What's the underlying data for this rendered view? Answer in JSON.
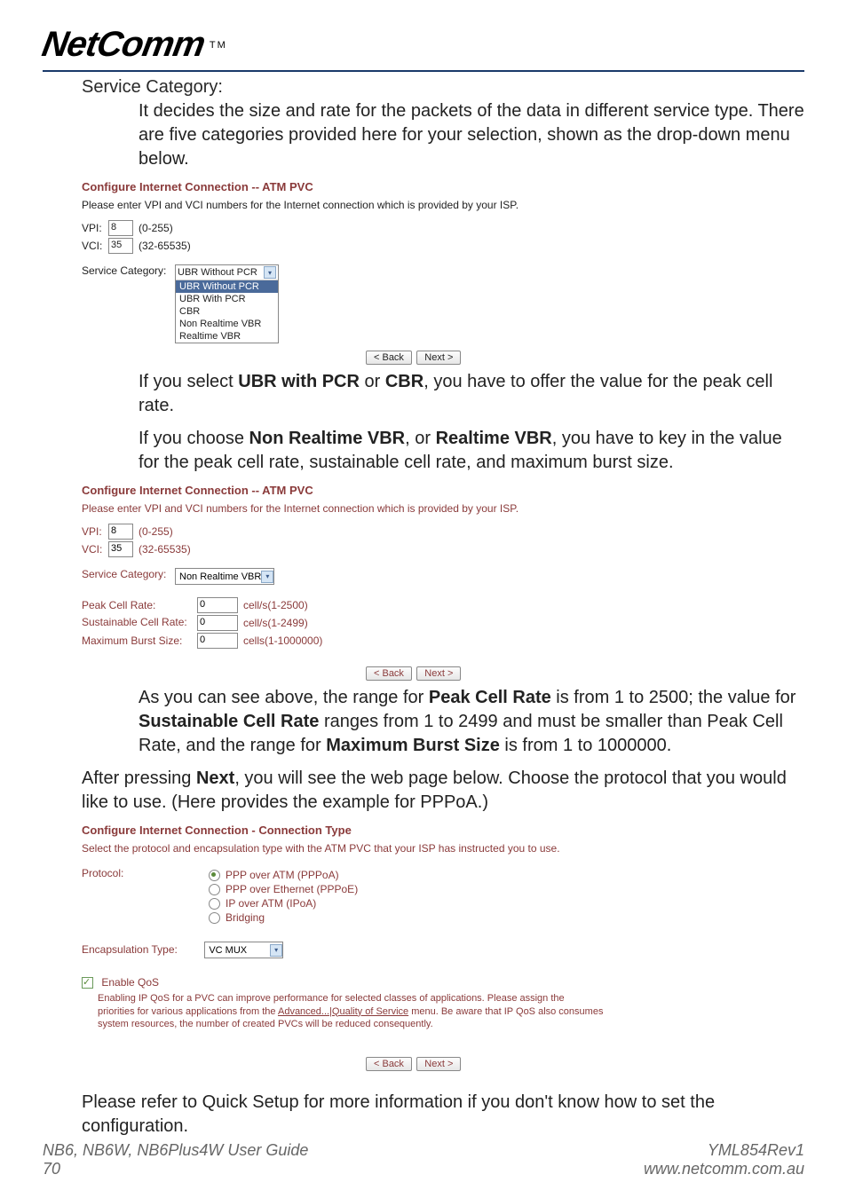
{
  "logo": "NetComm",
  "tm": "TM",
  "section_title": "Service Category:",
  "para1_a": "It decides the size and rate for the packets of the data in different service type. There are five categories provided here for your selection, shown as the drop-down menu below.",
  "shot1": {
    "title": "Configure Internet Connection -- ATM PVC",
    "plain": "Please enter VPI and VCI numbers for the Internet connection which is provided by your ISP.",
    "vpi_label": "VPI:",
    "vpi_value": "8",
    "vpi_range": "(0-255)",
    "vci_label": "VCI:",
    "vci_value": "35",
    "vci_range": "(32-65535)",
    "sc_label": "Service Category:",
    "dd_selected": "UBR Without PCR",
    "dd_options": [
      "UBR Without PCR",
      "UBR With PCR",
      "CBR",
      "Non Realtime VBR",
      "Realtime VBR"
    ],
    "back": "< Back",
    "next": "Next >"
  },
  "para2_a": "If you select ",
  "para2_b": "UBR with PCR",
  "para2_c": " or ",
  "para2_d": "CBR",
  "para2_e": ", you have to offer the value for the peak cell rate.",
  "para3_a": "If you choose ",
  "para3_b": "Non Realtime VBR",
  "para3_c": ", or ",
  "para3_d": "Realtime VBR",
  "para3_e": ", you have to key in the value for the peak cell rate, sustainable cell rate, and maximum burst size.",
  "shot2": {
    "title": "Configure Internet Connection -- ATM PVC",
    "plain": "Please enter VPI and VCI numbers for the Internet connection which is provided by your ISP.",
    "vpi_label": "VPI:",
    "vpi_value": "8",
    "vpi_range": "(0-255)",
    "vci_label": "VCI:",
    "vci_value": "35",
    "vci_range": "(32-65535)",
    "sc_label": "Service Category:",
    "sc_selected": "Non Realtime VBR",
    "pcr_label": "Peak Cell Rate:",
    "pcr_value": "0",
    "pcr_range": "cell/s(1-2500)",
    "scr_label": "Sustainable Cell Rate:",
    "scr_value": "0",
    "scr_range": "cell/s(1-2499)",
    "mbs_label": "Maximum Burst Size:",
    "mbs_value": "0",
    "mbs_range": "cells(1-1000000)",
    "back": "< Back",
    "next": "Next >"
  },
  "para4_a": "As you can see above, the range for ",
  "para4_b": "Peak Cell Rate",
  "para4_c": " is from 1 to 2500; the value for ",
  "para4_d": "Sustainable Cell Rate",
  "para4_e": " ranges from 1 to 2499 and must be smaller than Peak Cell Rate, and the range for ",
  "para4_f": "Maximum Burst Size",
  "para4_g": " is from 1 to 1000000.",
  "para5_a": "After pressing ",
  "para5_b": "Next",
  "para5_c": ", you will see the web page below. Choose the protocol that you would like to use. (Here provides the example for PPPoA.)",
  "shot3": {
    "title": "Configure Internet Connection - Connection Type",
    "plain": "Select the protocol and encapsulation type with the ATM PVC that your ISP has instructed you to use.",
    "protocol_label": "Protocol:",
    "opts": [
      "PPP over ATM (PPPoA)",
      "PPP over Ethernet (PPPoE)",
      "IP over ATM (IPoA)",
      "Bridging"
    ],
    "encap_label": "Encapsulation Type:",
    "encap_value": "VC MUX",
    "qos_label": "Enable QoS",
    "qos_note_a": "Enabling IP QoS for a PVC can improve performance for selected classes of applications. Please assign the priorities for various applications from the ",
    "qos_link": "Advanced...|Quality of Service",
    "qos_note_b": " menu. Be aware that IP QoS also consumes system resources, the number of created PVCs will be reduced consequently.",
    "back": "< Back",
    "next": "Next >"
  },
  "para6": "Please refer to Quick Setup for more information if you don't know how to set the configuration.",
  "footer": {
    "left1": "NB6, NB6W, NB6Plus4W User Guide",
    "left2": "70",
    "right1": "YML854Rev1",
    "right2": "www.netcomm.com.au"
  }
}
